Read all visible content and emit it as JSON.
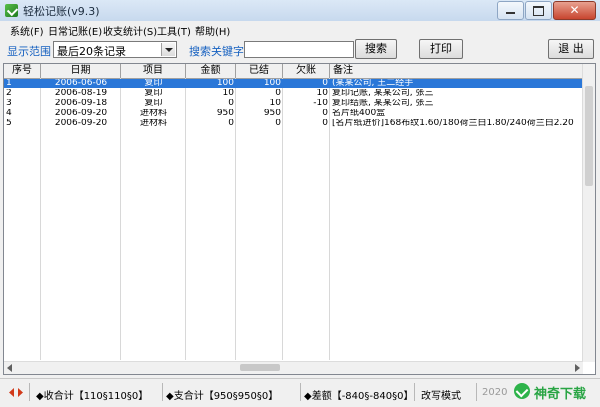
{
  "window": {
    "title": "轻松记账(v9.3)"
  },
  "menu": [
    "系统(F)",
    "日常记账(E)",
    "收支统计(S)",
    "工具(T)",
    "帮助(H)"
  ],
  "toolbar": {
    "range_label": "显示范围",
    "range_value": "最后20条记录",
    "search_label": "搜索关键字",
    "search_value": "",
    "search_button": "搜索",
    "print_button": "打印",
    "exit_button": "退 出"
  },
  "table": {
    "columns": [
      "序号",
      "日期",
      "项目",
      "金额",
      "已结",
      "欠账",
      "备注"
    ],
    "rows": [
      [
        "1",
        "2006-06-06",
        "复印",
        "100",
        "100",
        "0",
        "(某某公司, 王二经手"
      ],
      [
        "2",
        "2006-08-19",
        "复印",
        "10",
        "0",
        "10",
        "复印记账, 某某公司, 张三"
      ],
      [
        "3",
        "2006-09-18",
        "复印",
        "0",
        "10",
        "-10",
        "复印结账, 某某公司, 张三"
      ],
      [
        "4",
        "2006-09-20",
        "进材料",
        "950",
        "950",
        "0",
        "名片纸400盒"
      ],
      [
        "5",
        "2006-09-20",
        "进材料",
        "0",
        "0",
        "0",
        "[名片纸进价]168布纹1.60/180荷兰白1.80/240荷兰白2.20"
      ]
    ]
  },
  "status": {
    "income": "◆收合计【110§110§0】",
    "expense": "◆支合计【950§950§0】",
    "diff": "◆差额【-840§-840§0】",
    "mode": "改写模式",
    "year": "2020"
  },
  "watermark": {
    "brand": "神奇下载"
  },
  "colors": {
    "accent": "#1560c0",
    "selected_row": "#2a77d8",
    "brand_green": "#2aa545"
  }
}
